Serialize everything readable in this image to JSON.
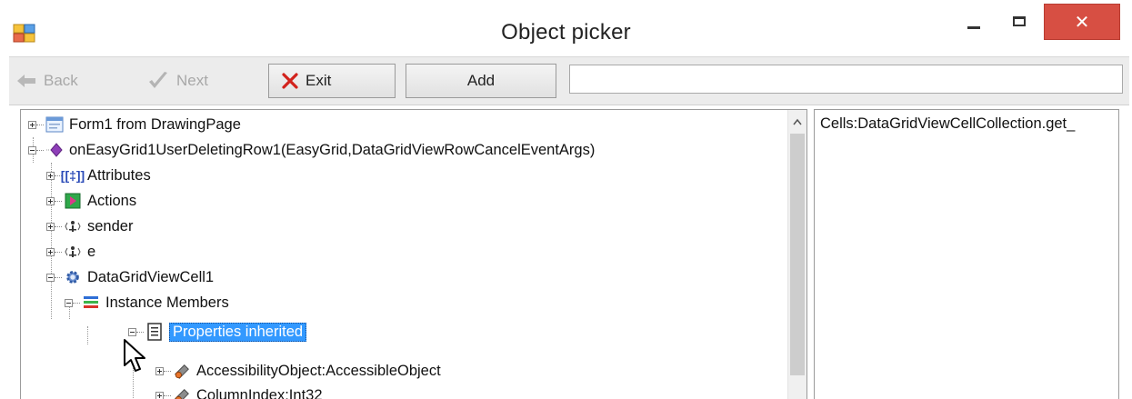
{
  "window": {
    "title": "Object picker",
    "close_glyph": "✕"
  },
  "toolbar": {
    "back_label": "Back",
    "next_label": "Next",
    "exit_label": "Exit",
    "add_label": "Add",
    "search_value": ""
  },
  "tree": {
    "rows": [
      {
        "label": "Form1 from DrawingPage",
        "icon": "form-icon",
        "expanded": false
      },
      {
        "label": "onEasyGrid1UserDeletingRow1(EasyGrid,DataGridViewRowCancelEventArgs)",
        "icon": "method-icon",
        "expanded": true
      },
      {
        "label": "Attributes",
        "icon": "attributes-icon",
        "expanded": false
      },
      {
        "label": "Actions",
        "icon": "actions-icon",
        "expanded": false
      },
      {
        "label": "sender",
        "icon": "parameter-icon",
        "expanded": false
      },
      {
        "label": "e",
        "icon": "parameter-icon",
        "expanded": false
      },
      {
        "label": "DataGridViewCell1",
        "icon": "gear-icon",
        "expanded": true
      },
      {
        "label": "Instance Members",
        "icon": "members-icon",
        "expanded": true
      },
      {
        "label": "Properties inherited",
        "icon": "properties-icon",
        "expanded": true,
        "selected": true
      },
      {
        "label": "AccessibilityObject:AccessibleObject",
        "icon": "property-icon",
        "expanded": false
      },
      {
        "label": "ColumnIndex:Int32",
        "icon": "property-icon",
        "expanded": false
      }
    ]
  },
  "detail": {
    "text": "Cells:DataGridViewCellCollection.get_"
  },
  "colors": {
    "selection": "#3399ff",
    "close_button": "#d74f43"
  }
}
